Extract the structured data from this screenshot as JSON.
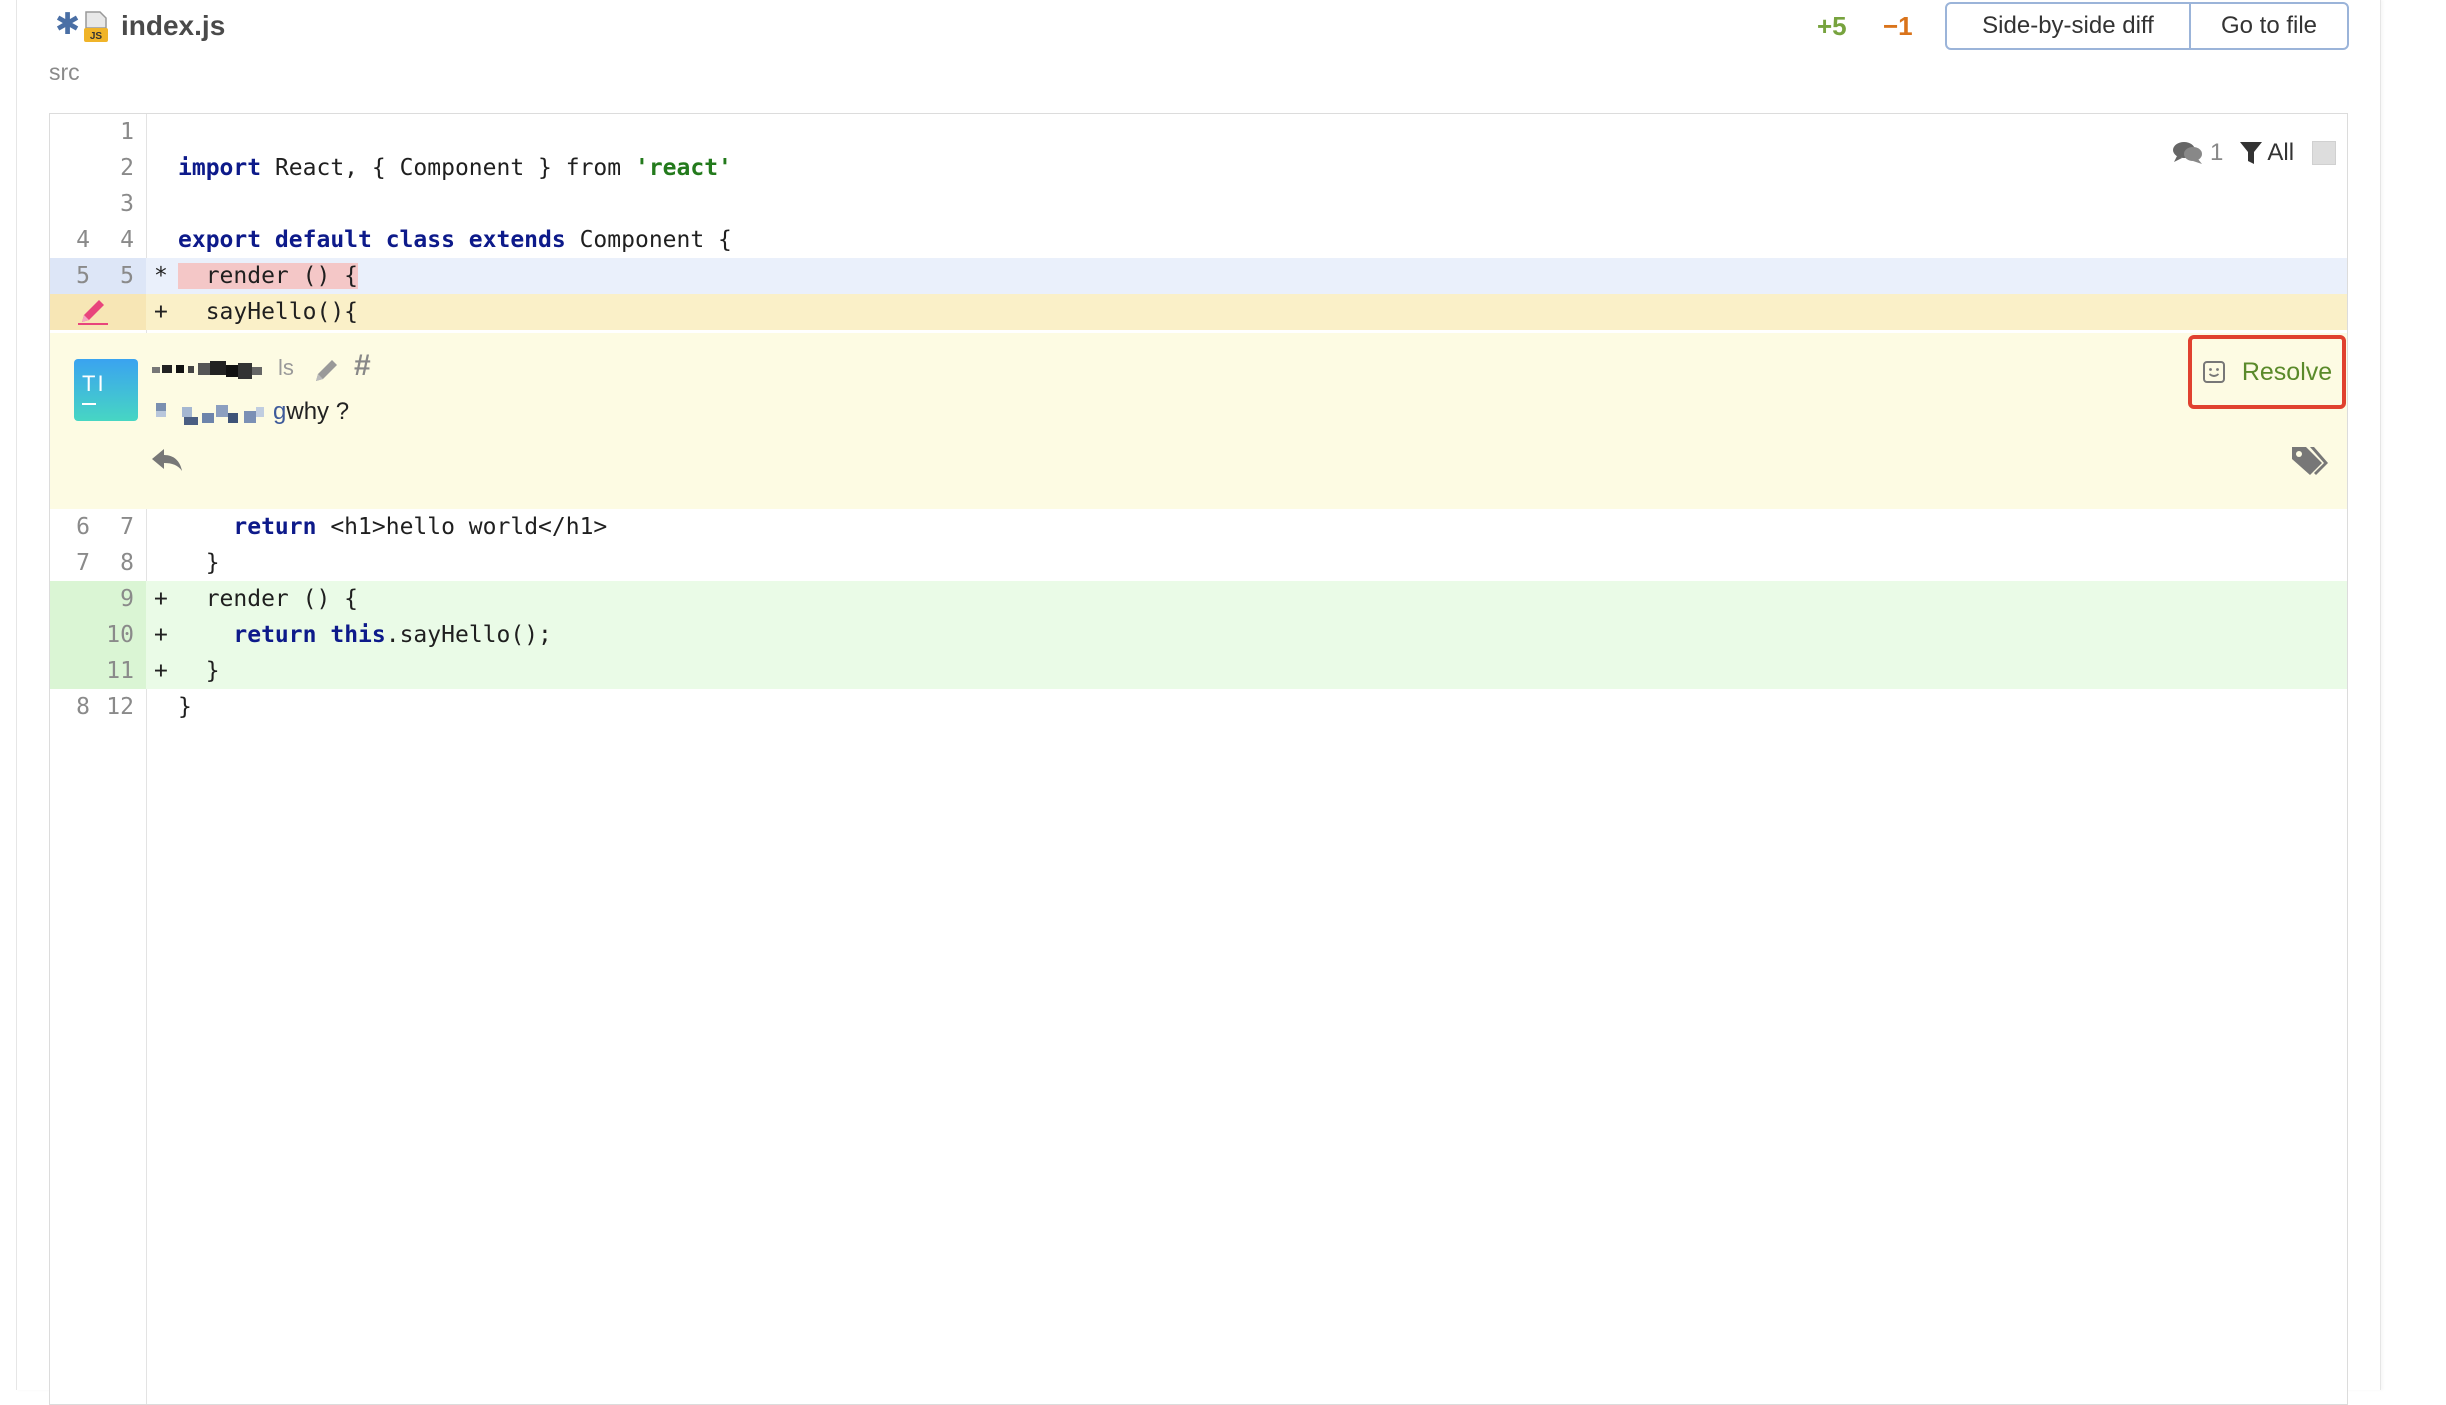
{
  "file": {
    "name": "index.js",
    "directory": "src",
    "additions": "+5",
    "deletions": "−1"
  },
  "toolbar": {
    "side_by_side_label": "Side-by-side diff",
    "go_to_file_label": "Go to file"
  },
  "code_tools": {
    "comment_count": "1",
    "filter_label": "All"
  },
  "lines": [
    {
      "old": "",
      "new": "1",
      "marker": "",
      "type": "context"
    },
    {
      "old": "",
      "new": "2",
      "marker": "",
      "type": "context"
    },
    {
      "old": "",
      "new": "3",
      "marker": "",
      "type": "context"
    },
    {
      "old": "4",
      "new": "4",
      "marker": "",
      "type": "context"
    },
    {
      "old": "5",
      "new": "5",
      "marker": "*",
      "type": "modified"
    },
    {
      "old": "",
      "new": "",
      "marker": "+",
      "type": "commented"
    },
    {
      "old": "6",
      "new": "7",
      "marker": "",
      "type": "context"
    },
    {
      "old": "7",
      "new": "8",
      "marker": "",
      "type": "context"
    },
    {
      "old": "",
      "new": "9",
      "marker": "+",
      "type": "added"
    },
    {
      "old": "",
      "new": "10",
      "marker": "+",
      "type": "added"
    },
    {
      "old": "",
      "new": "11",
      "marker": "+",
      "type": "added"
    },
    {
      "old": "8",
      "new": "12",
      "marker": "",
      "type": "context"
    }
  ],
  "code": {
    "l2_kw": "import",
    "l2_text": " React, { Component } from ",
    "l2_str": "'react'",
    "l4_kw": "export default class extends",
    "l4_text": " Component {",
    "l5_text": "  render () {",
    "l6_text": "  sayHello(){",
    "l7_kw": "return",
    "l7_text": " <h1>hello world</h1>",
    "l8_text": "  }",
    "l9_text": "  render () {",
    "l10_kw1": "return",
    "l10_kw2": "this",
    "l10_text": ".sayHello();",
    "l11_text": "  }",
    "l12_text": "}"
  },
  "comment": {
    "avatar_initials": "TI",
    "time": "ls",
    "body_tail": "g",
    "body_text": " why ?",
    "resolve_label": "Resolve"
  },
  "colors": {
    "additions": "#77a33e",
    "deletions": "#d9731a",
    "resolve_border": "#e0412f",
    "resolve_text": "#5a8a2a"
  }
}
